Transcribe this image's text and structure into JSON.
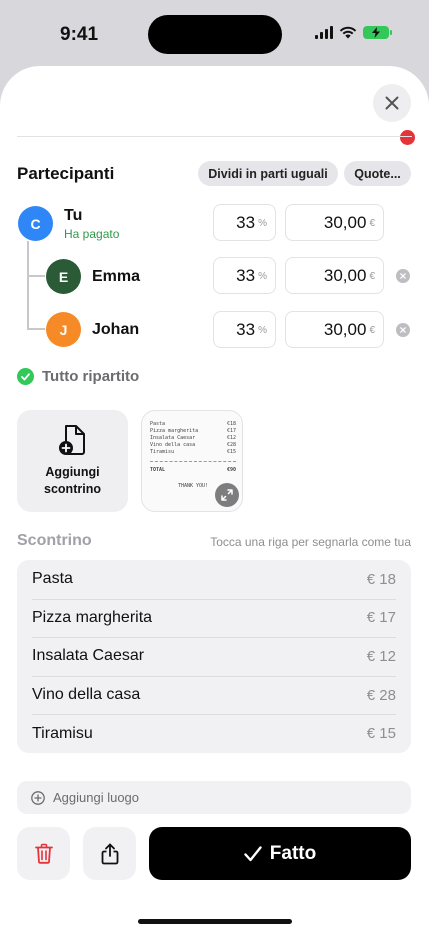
{
  "status": {
    "time": "9:41"
  },
  "header": {
    "close_icon": "xmark-icon"
  },
  "participants": {
    "title": "Partecipanti",
    "equal_split_label": "Dividi in parti uguali",
    "shares_label": "Quote...",
    "people": [
      {
        "initial": "C",
        "name": "Tu",
        "subtitle": "Ha pagato",
        "percent": "33",
        "amount": "30,00",
        "color": "#2f86f6"
      },
      {
        "initial": "E",
        "name": "Emma",
        "percent": "33",
        "amount": "30,00",
        "color": "#2b5a36"
      },
      {
        "initial": "J",
        "name": "Johan",
        "percent": "33",
        "amount": "30,00",
        "color": "#f58a26"
      }
    ],
    "percent_unit": "%",
    "currency_unit": "€",
    "fully_split_label": "Tutto ripartito"
  },
  "receipt_media": {
    "add_label_line1": "Aggiungi",
    "add_label_line2": "scontrino",
    "thumbnail": {
      "lines": [
        {
          "item": "Pasta",
          "price": "€18"
        },
        {
          "item": "Pizza margherita",
          "price": "€17"
        },
        {
          "item": "Insalata Caesar",
          "price": "€12"
        },
        {
          "item": "Vino della casa",
          "price": "€28"
        },
        {
          "item": "Tiramisu",
          "price": "€15"
        }
      ],
      "total_label": "TOTAL",
      "total_value": "€90",
      "footer": "THANK YOU!"
    }
  },
  "receipt": {
    "title": "Scontrino",
    "hint": "Tocca una riga per segnarla come tua",
    "items": [
      {
        "name": "Pasta",
        "price": "€ 18"
      },
      {
        "name": "Pizza margherita",
        "price": "€ 17"
      },
      {
        "name": "Insalata Caesar",
        "price": "€ 12"
      },
      {
        "name": "Vino della casa",
        "price": "€ 28"
      },
      {
        "name": "Tiramisu",
        "price": "€ 15"
      }
    ]
  },
  "add_place": {
    "label": "Aggiungi luogo"
  },
  "actions": {
    "delete_icon": "trash-icon",
    "share_icon": "share-icon",
    "done_label": "Fatto"
  },
  "colors": {
    "accent_green": "#34c759",
    "paid_green": "#2e9b4b",
    "delete_red": "#e5333a"
  }
}
